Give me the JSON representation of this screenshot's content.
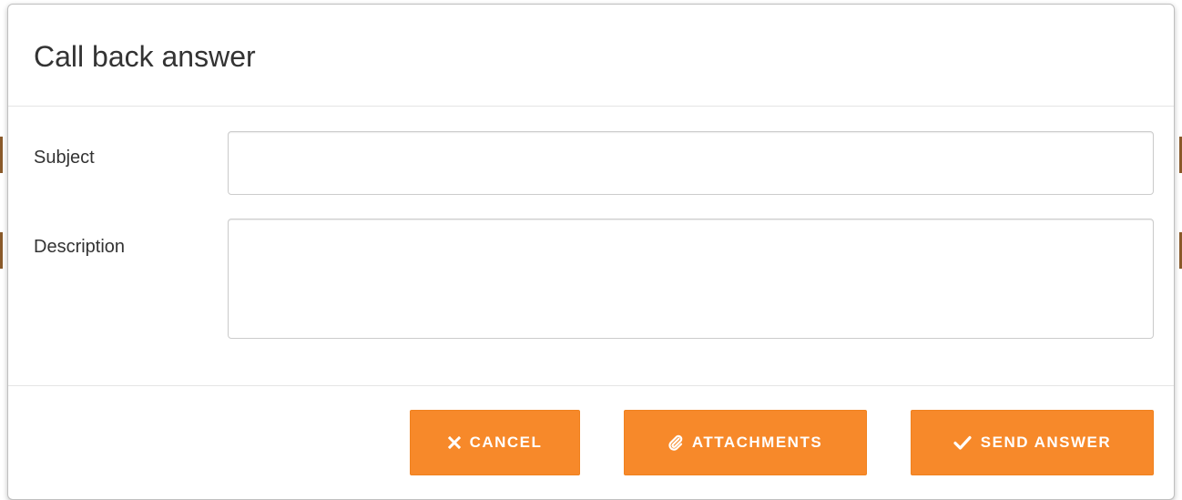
{
  "dialog": {
    "title": "Call back answer"
  },
  "form": {
    "subject": {
      "label": "Subject",
      "value": "",
      "placeholder": ""
    },
    "description": {
      "label": "Description",
      "value": "",
      "placeholder": ""
    }
  },
  "footer": {
    "cancel": {
      "label": "CANCEL",
      "icon": "close-icon"
    },
    "attachments": {
      "label": "ATTACHMENTS",
      "icon": "paperclip-icon"
    },
    "send": {
      "label": "SEND ANSWER",
      "icon": "checkmark-icon"
    }
  },
  "colors": {
    "accent": "#f7892a",
    "text": "#333333",
    "border": "#cccccc"
  }
}
